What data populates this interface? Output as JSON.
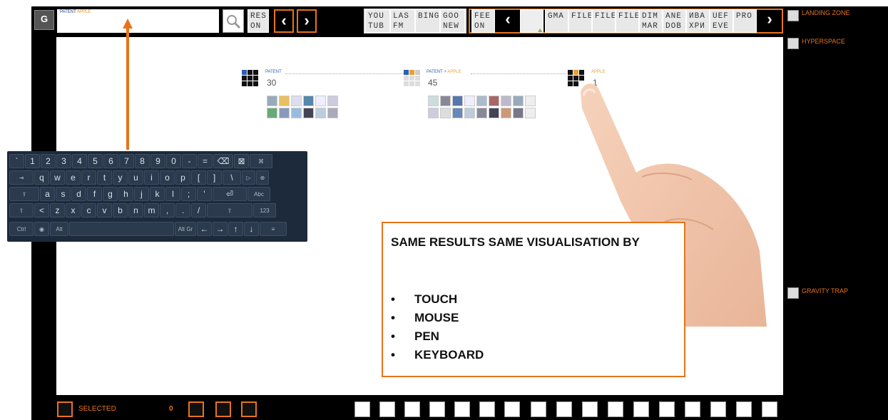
{
  "app": {
    "logo_text": "G",
    "logo_subtext": "greatgalleons"
  },
  "search": {
    "query_part1": "PATENT",
    "query_part2": "APPLE"
  },
  "top_buttons": {
    "reset_label": "RES\nON",
    "tabs_left": [
      "YOU\nTUB",
      "LAS\nFM",
      "BING",
      "GOO\nNEW"
    ],
    "tabs_right": [
      "FEE\nON",
      "",
      "GMA",
      "FILE",
      "FILE",
      "FILE",
      "DIM\nMAR",
      "ANE\nDOB",
      "ИВА\nХРИ",
      "UEF\nEVE",
      "PRO"
    ]
  },
  "right_panel": {
    "landing_zone": "LANDING ZONE",
    "hyperspace": "HYPERSPACE",
    "gravity_trap": "GRAVITY TRAP"
  },
  "keyboard": {
    "rows": [
      [
        "`",
        "1",
        "2",
        "3",
        "4",
        "5",
        "6",
        "7",
        "8",
        "9",
        "0",
        "-",
        "=",
        "⌫",
        "⊠",
        "⌘"
      ],
      [
        "⇥",
        "q",
        "w",
        "e",
        "r",
        "t",
        "y",
        "u",
        "i",
        "o",
        "p",
        "[",
        "]",
        "\\",
        "▷",
        "⊕"
      ],
      [
        "⇪",
        "a",
        "s",
        "d",
        "f",
        "g",
        "h",
        "j",
        "k",
        "l",
        ";",
        "'",
        "⏎",
        "Abc"
      ],
      [
        "⇧",
        "<",
        "z",
        "x",
        "c",
        "v",
        "b",
        "n",
        "m",
        ",",
        ".",
        "/",
        "⇧",
        "123"
      ],
      [
        "Ctrl",
        "◉",
        "Alt",
        " ",
        "Alt Gr",
        "←",
        "→",
        "↑",
        "↓",
        "≡"
      ]
    ]
  },
  "visualization": {
    "groups": [
      {
        "label": "PATENT",
        "count": "30"
      },
      {
        "label_part1": "PATENT",
        "label_op": " + ",
        "label_part2": "APPLE",
        "count": "45"
      },
      {
        "label": "APPLE",
        "count": "1"
      }
    ]
  },
  "callout": {
    "heading": "SAME RESULTS  SAME VISUALISATION BY",
    "items": [
      "TOUCH",
      "MOUSE",
      "PEN",
      "KEYBOARD"
    ],
    "bullet": "•"
  },
  "bottom_bar": {
    "selected_label": "SELECTED",
    "selected_count": "0"
  },
  "colors": {
    "accent": "#e8731a",
    "blue": "#2f5fae",
    "background": "#000000"
  }
}
